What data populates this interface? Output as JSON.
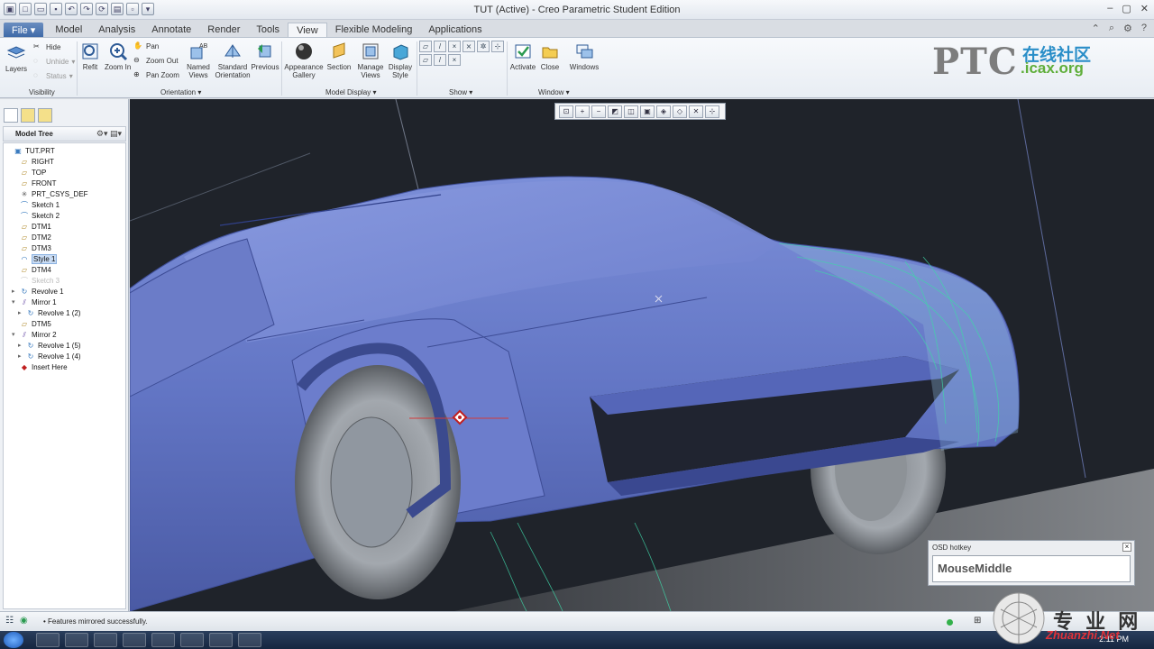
{
  "window": {
    "title": "TUT (Active) - Creo Parametric Student Edition"
  },
  "tabs": [
    "File",
    "Model",
    "Analysis",
    "Annotate",
    "Render",
    "Tools",
    "View",
    "Flexible Modeling",
    "Applications"
  ],
  "active_tab": "View",
  "ribbon": {
    "layers": "Layers",
    "hide": "Hide",
    "unhide": "Unhide",
    "status": "Status",
    "refit": "Refit",
    "zoom_in": "Zoom In",
    "pan": "Pan",
    "zoom_out": "Zoom Out",
    "pan_zoom": "Pan Zoom",
    "named_views": "Named Views",
    "standard_orientation": "Standard Orientation",
    "previous": "Previous",
    "appearance_gallery": "Appearance Gallery",
    "section": "Section",
    "manage_views": "Manage Views",
    "display_style": "Display Style",
    "activate": "Activate",
    "close": "Close",
    "windows": "Windows",
    "groups": {
      "visibility": "Visibility",
      "orientation": "Orientation",
      "model_display": "Model Display",
      "show": "Show",
      "window": "Window"
    }
  },
  "logo": {
    "brand": "PTC",
    "cn": "在线社区",
    "url": ".icax.org"
  },
  "model_tree": {
    "title": "Model Tree",
    "items": [
      {
        "label": "TUT.PRT",
        "indent": 0,
        "icon": "part-icon"
      },
      {
        "label": "RIGHT",
        "indent": 1,
        "icon": "datum-plane-icon"
      },
      {
        "label": "TOP",
        "indent": 1,
        "icon": "datum-plane-icon"
      },
      {
        "label": "FRONT",
        "indent": 1,
        "icon": "datum-plane-icon"
      },
      {
        "label": "PRT_CSYS_DEF",
        "indent": 1,
        "icon": "csys-icon"
      },
      {
        "label": "Sketch 1",
        "indent": 1,
        "icon": "sketch-icon"
      },
      {
        "label": "Sketch 2",
        "indent": 1,
        "icon": "sketch-icon"
      },
      {
        "label": "DTM1",
        "indent": 1,
        "icon": "datum-plane-icon"
      },
      {
        "label": "DTM2",
        "indent": 1,
        "icon": "datum-plane-icon"
      },
      {
        "label": "DTM3",
        "indent": 1,
        "icon": "datum-plane-icon"
      },
      {
        "label": "Style 1",
        "indent": 1,
        "icon": "style-icon",
        "selected": true
      },
      {
        "label": "DTM4",
        "indent": 1,
        "icon": "datum-plane-icon"
      },
      {
        "label": "Sketch 3",
        "indent": 1,
        "icon": "sketch-icon",
        "dim": true
      },
      {
        "label": "Revolve 1",
        "indent": 1,
        "icon": "revolve-icon",
        "expandable": true
      },
      {
        "label": "Mirror 1",
        "indent": 1,
        "icon": "mirror-icon",
        "expanded": true
      },
      {
        "label": "Revolve 1 (2)",
        "indent": 2,
        "icon": "revolve-icon",
        "expandable": true
      },
      {
        "label": "DTM5",
        "indent": 1,
        "icon": "datum-plane-icon"
      },
      {
        "label": "Mirror 2",
        "indent": 1,
        "icon": "mirror-icon",
        "expanded": true
      },
      {
        "label": "Revolve 1 (5)",
        "indent": 2,
        "icon": "revolve-icon",
        "expandable": true
      },
      {
        "label": "Revolve 1 (4)",
        "indent": 2,
        "icon": "revolve-icon",
        "expandable": true
      },
      {
        "label": "Insert Here",
        "indent": 1,
        "icon": "insert-here-icon"
      }
    ]
  },
  "osd": {
    "title": "OSD hotkey",
    "value": "MouseMiddle"
  },
  "status": {
    "message": "Features mirrored successfully."
  },
  "taskbar": {
    "clock": "2:11 PM"
  },
  "watermark": {
    "cn": "专 业 网",
    "url": "Zhuanzhi.Net"
  }
}
